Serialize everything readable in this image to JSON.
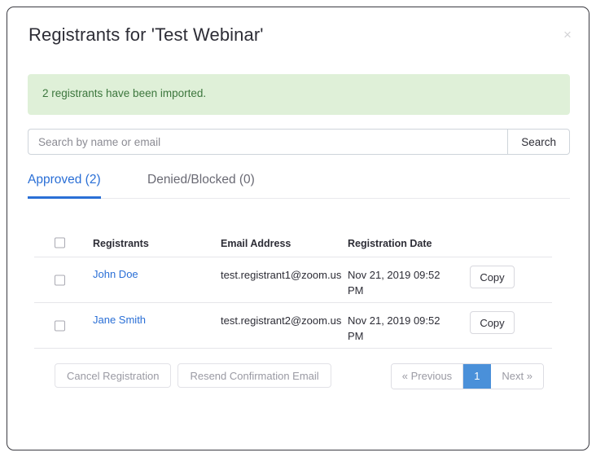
{
  "modal": {
    "title": "Registrants for 'Test Webinar'",
    "close_icon": "close-icon",
    "close_label": "×"
  },
  "alert": {
    "message": "2 registrants have been imported.",
    "bg_color": "#dff0d8",
    "text_color": "#3c763d"
  },
  "search": {
    "placeholder": "Search by name or email",
    "value": "",
    "button_label": "Search"
  },
  "tabs": [
    {
      "label": "Approved (2)",
      "active": true,
      "accent_color": "#2a6fd6"
    },
    {
      "label": "Denied/Blocked (0)",
      "active": false
    }
  ],
  "table": {
    "columns": [
      "Registrants",
      "Email Address",
      "Registration Date"
    ],
    "select_all_checked": false,
    "rows": [
      {
        "checked": false,
        "name": "John Doe",
        "email": "test.registrant1@zoom.us",
        "date": "Nov 21, 2019 09:52 PM",
        "action_label": "Copy"
      },
      {
        "checked": false,
        "name": "Jane Smith",
        "email": "test.registrant2@zoom.us",
        "date": "Nov 21, 2019 09:52 PM",
        "action_label": "Copy"
      }
    ]
  },
  "footer": {
    "cancel_registration_label": "Cancel Registration",
    "resend_confirmation_label": "Resend Confirmation Email"
  },
  "pagination": {
    "previous_label": "« Previous",
    "current_page": "1",
    "next_label": "Next »",
    "active_color": "#4a90d9"
  }
}
